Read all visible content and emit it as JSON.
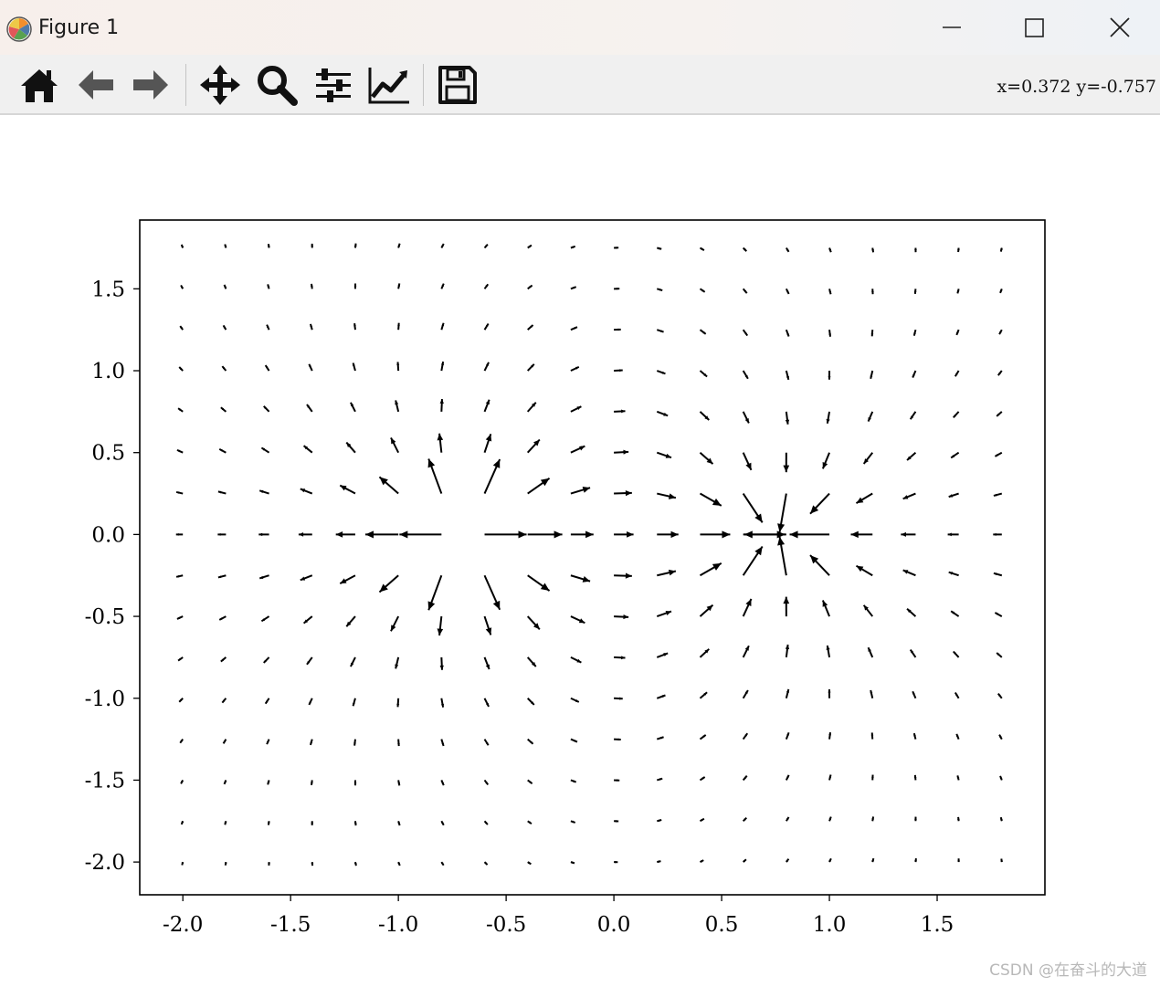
{
  "window": {
    "title": "Figure 1",
    "app_icon": "matplotlib-logo-icon",
    "controls": [
      "minimize-icon",
      "maximize-icon",
      "close-icon"
    ]
  },
  "toolbar": {
    "buttons": [
      {
        "name": "home",
        "icon": "home-icon"
      },
      {
        "name": "back",
        "icon": "arrow-left-icon"
      },
      {
        "name": "forward",
        "icon": "arrow-right-icon"
      },
      {
        "name": "pan",
        "icon": "move-arrows-icon"
      },
      {
        "name": "zoom",
        "icon": "magnifier-icon"
      },
      {
        "name": "configure-subplots",
        "icon": "sliders-icon"
      },
      {
        "name": "edit-axis",
        "icon": "line-chart-icon"
      },
      {
        "name": "save",
        "icon": "floppy-disk-icon"
      }
    ],
    "coordinates": "x=0.372  y=-0.757"
  },
  "chart_data": {
    "type": "quiver",
    "title": "",
    "xlabel": "",
    "ylabel": "",
    "xlim": [
      -2.2,
      2.0
    ],
    "ylim": [
      -2.2,
      1.92
    ],
    "xticks": [
      -2.0,
      -1.5,
      -1.0,
      -0.5,
      0.0,
      0.5,
      1.0,
      1.5
    ],
    "xtick_labels": [
      "-2.0",
      "-1.5",
      "-1.0",
      "-0.5",
      "0.0",
      "0.5",
      "1.0",
      "1.5"
    ],
    "yticks": [
      -2.0,
      -1.5,
      -1.0,
      -0.5,
      0.0,
      0.5,
      1.0,
      1.5
    ],
    "ytick_labels": [
      "-2.0",
      "-1.5",
      "-1.0",
      "-0.5",
      "0.0",
      "0.5",
      "1.0",
      "1.5"
    ],
    "grid": false,
    "x": [
      -2.0,
      -1.8,
      -1.6,
      -1.4,
      -1.2,
      -1.0,
      -0.8,
      -0.6,
      -0.4,
      -0.2,
      0.0,
      0.2,
      0.4,
      0.6,
      0.8,
      1.0,
      1.2,
      1.4,
      1.6,
      1.8
    ],
    "y": [
      -2.0,
      -1.75,
      -1.5,
      -1.25,
      -1.0,
      -0.75,
      -0.5,
      -0.25,
      0.0,
      0.25,
      0.5,
      0.75,
      1.0,
      1.25,
      1.5,
      1.75
    ],
    "source_charge": {
      "x": -0.7,
      "y": 0.0
    },
    "sink_charge": {
      "x": 0.75,
      "y": 0.0
    },
    "arrow_color": "#000000"
  },
  "watermark": "CSDN @在奋斗的大道"
}
